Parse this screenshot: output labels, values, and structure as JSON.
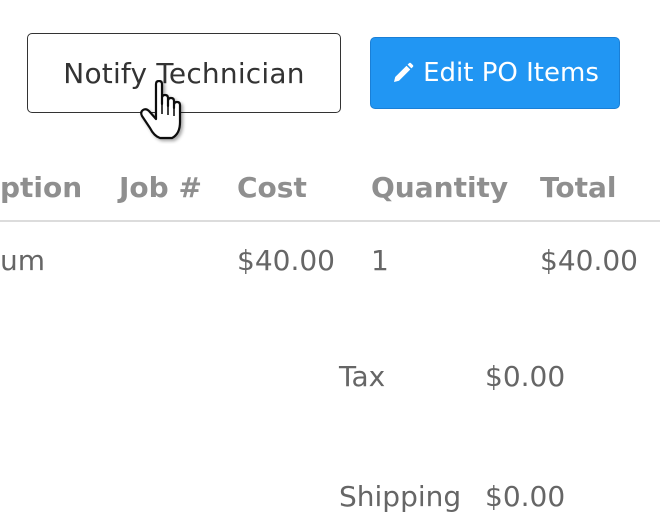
{
  "toolbar": {
    "notify_label": "Notify Technician",
    "edit_label": "Edit PO Items",
    "edit_icon": "pencil-icon",
    "accent_color": "#2196f3"
  },
  "table": {
    "headers": [
      "ption",
      "Job #",
      "Cost",
      "Quantity",
      "Total"
    ],
    "rows": [
      [
        "um",
        "",
        "$40.00",
        "1",
        "$40.00"
      ]
    ]
  },
  "summary": {
    "tax_label": "Tax",
    "tax_value": "$0.00",
    "shipping_label": "Shipping",
    "shipping_value": "$0.00"
  }
}
